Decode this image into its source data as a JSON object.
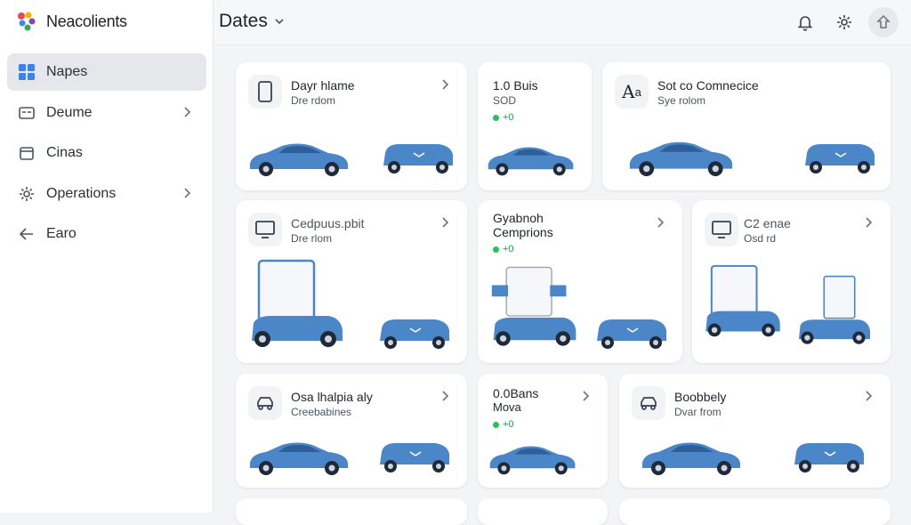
{
  "app": {
    "name": "Neacolients"
  },
  "header": {
    "title": "Dates"
  },
  "sidebar": {
    "items": [
      {
        "label": "Napes",
        "active": true,
        "icon": "grid-icon",
        "chevron": false
      },
      {
        "label": "Deume",
        "active": false,
        "icon": "inbox-icon",
        "chevron": true
      },
      {
        "label": "Cinas",
        "active": false,
        "icon": "calendar-icon",
        "chevron": false
      },
      {
        "label": "Operations",
        "active": false,
        "icon": "gear-icon",
        "chevron": true
      },
      {
        "label": "Earo",
        "active": false,
        "icon": "back-arrow-icon",
        "chevron": false
      }
    ]
  },
  "cards": [
    {
      "title": "Dayr hlame",
      "subtitle": "Dre rdom",
      "icon": "phone-icon"
    },
    {
      "title": "1.0 Buis",
      "subtitle": "SOD",
      "stat": "+0",
      "icon": ""
    },
    {
      "title": "Sot co Comnecice",
      "subtitle": "Sye rolom",
      "icon": "text-icon"
    },
    {
      "title": "Cedpuus.pbit",
      "subtitle": "Dre rlom",
      "icon": "monitor-icon"
    },
    {
      "title": "Gyabnoh",
      "subtitle": "Cemprions",
      "stat": "+0",
      "icon": ""
    },
    {
      "title": "C2 enae",
      "subtitle": "Osd rd",
      "icon": "monitor-icon"
    },
    {
      "title": "Osa lhalpia aly",
      "subtitle": "Creebabines",
      "icon": "car-icon"
    },
    {
      "title": "0.0Bans",
      "subtitle": "Mova",
      "stat": "+0",
      "icon": ""
    },
    {
      "title": "Boobbely",
      "subtitle": "Dvar from",
      "icon": "car-icon"
    }
  ],
  "colors": {
    "car_blue": "#4a86c8",
    "accent_green": "#22c55e",
    "logo": [
      "#e34b5b",
      "#f4b400",
      "#34a853",
      "#8e44ad",
      "#4285f4"
    ]
  }
}
